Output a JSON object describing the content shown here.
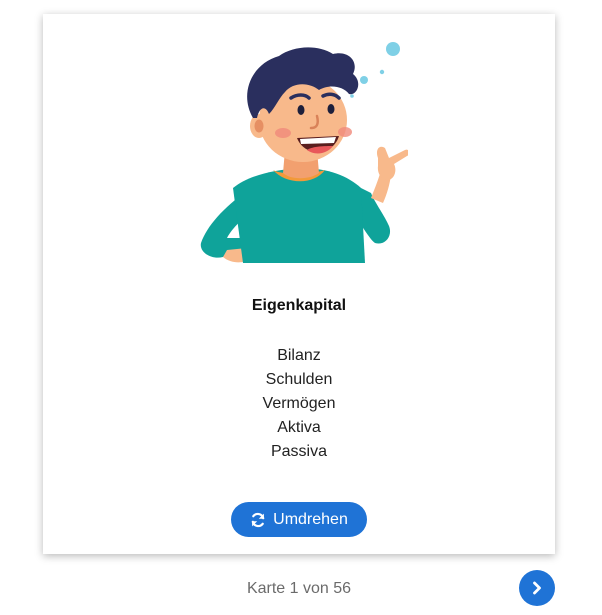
{
  "card": {
    "title": "Eigenkapital",
    "terms": [
      "Bilanz",
      "Schulden",
      "Vermögen",
      "Aktiva",
      "Passiva"
    ],
    "flip_label": "Umdrehen",
    "flip_icon": "refresh-icon",
    "illustration": "cartoon-boy-pointing"
  },
  "footer": {
    "counter": "Karte 1 von 56",
    "next_icon": "chevron-right-icon"
  },
  "colors": {
    "accent": "#1f73d6",
    "shirt": "#0fa39a",
    "hair": "#2a2f5e",
    "skin": "#f8b98b"
  }
}
